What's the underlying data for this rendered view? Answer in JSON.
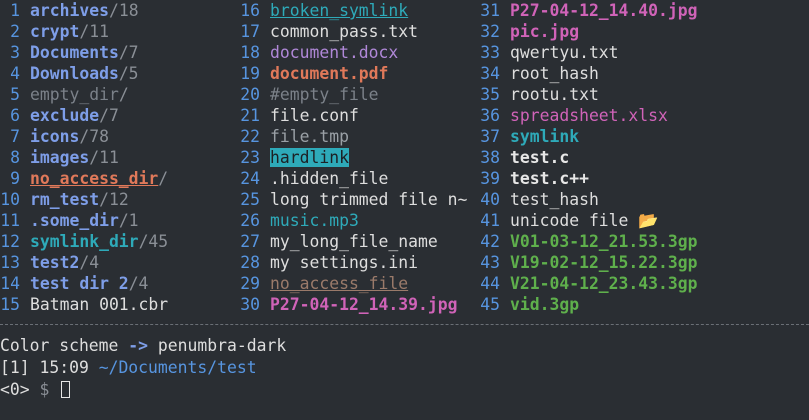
{
  "listing": {
    "col1": [
      {
        "n": "1",
        "name": "archives",
        "suffix": "/18",
        "kind": "dir"
      },
      {
        "n": "2",
        "name": "crypt",
        "suffix": "/11",
        "kind": "dir"
      },
      {
        "n": "3",
        "name": "Documents",
        "suffix": "/7",
        "kind": "dir"
      },
      {
        "n": "4",
        "name": "Downloads",
        "suffix": "/5",
        "kind": "dir"
      },
      {
        "n": "5",
        "name": "empty_dir",
        "suffix": "/",
        "kind": "emptydir"
      },
      {
        "n": "6",
        "name": "exclude",
        "suffix": "/7",
        "kind": "excl"
      },
      {
        "n": "7",
        "name": "icons",
        "suffix": "/78",
        "kind": "dir"
      },
      {
        "n": "8",
        "name": "images",
        "suffix": "/11",
        "kind": "dir"
      },
      {
        "n": "9",
        "name": "no_access_dir",
        "suffix": "/",
        "kind": "noacc"
      },
      {
        "n": "10",
        "name": "rm_test",
        "suffix": "/12",
        "kind": "dir"
      },
      {
        "n": "11",
        "name": ".some_dir",
        "suffix": "/1",
        "kind": "dir"
      },
      {
        "n": "12",
        "name": "symlink_dir",
        "suffix": "/45",
        "kind": "symdir"
      },
      {
        "n": "13",
        "name": "test2",
        "suffix": "/4",
        "kind": "dir"
      },
      {
        "n": "14",
        "name": "test dir 2",
        "suffix": "/4",
        "kind": "dir"
      },
      {
        "n": "15",
        "name": "Batman 001.cbr",
        "suffix": "",
        "kind": "plain"
      }
    ],
    "col2": [
      {
        "n": "16",
        "name": "broken_symlink",
        "kind": "broken"
      },
      {
        "n": "17",
        "name": "common_pass.txt",
        "kind": "plain"
      },
      {
        "n": "18",
        "name": "document.docx",
        "kind": "doc"
      },
      {
        "n": "19",
        "name": "document.pdf",
        "kind": "pdf"
      },
      {
        "n": "20",
        "name": "#empty_file",
        "kind": "cmt"
      },
      {
        "n": "21",
        "name": "file.conf",
        "kind": "plain"
      },
      {
        "n": "22",
        "name": "file.tmp",
        "kind": "tmp"
      },
      {
        "n": "23",
        "name": "hardlink",
        "kind": "hl"
      },
      {
        "n": "24",
        "name": ".hidden_file",
        "kind": "plain"
      },
      {
        "n": "25",
        "name": "long trimmed file n~",
        "kind": "plain"
      },
      {
        "n": "26",
        "name": "music.mp3",
        "kind": "music"
      },
      {
        "n": "27",
        "name": "my_long_file_name",
        "kind": "plain"
      },
      {
        "n": "28",
        "name": "my settings.ini",
        "kind": "plain"
      },
      {
        "n": "29",
        "name": "no_access_file",
        "kind": "noaccf"
      },
      {
        "n": "30",
        "name": "P27-04-12_14.39.jpg",
        "kind": "img"
      }
    ],
    "col3": [
      {
        "n": "31",
        "name": "P27-04-12_14.40.jpg",
        "kind": "img"
      },
      {
        "n": "32",
        "name": "pic.jpg",
        "kind": "img"
      },
      {
        "n": "33",
        "name": "qwertyu.txt",
        "kind": "plain"
      },
      {
        "n": "34",
        "name": "root_hash",
        "kind": "plain"
      },
      {
        "n": "35",
        "name": "rootu.txt",
        "kind": "plain"
      },
      {
        "n": "36",
        "name": "spreadsheet.xlsx",
        "kind": "xls"
      },
      {
        "n": "37",
        "name": "symlink",
        "kind": "sym"
      },
      {
        "n": "38",
        "name": "test.c",
        "kind": "csrc"
      },
      {
        "n": "39",
        "name": "test.c++",
        "kind": "csrc"
      },
      {
        "n": "40",
        "name": "test_hash",
        "kind": "plain"
      },
      {
        "n": "41",
        "name": "unicode file 📂",
        "kind": "plain"
      },
      {
        "n": "42",
        "name": "V01-03-12_21.53.3gp",
        "kind": "green"
      },
      {
        "n": "43",
        "name": "V19-02-12_15.22.3gp",
        "kind": "green"
      },
      {
        "n": "44",
        "name": "V21-04-12_23.43.3gp",
        "kind": "green"
      },
      {
        "n": "45",
        "name": "vid.3gp",
        "kind": "green"
      }
    ]
  },
  "footer": {
    "scheme_label": "Color scheme",
    "arrow": "->",
    "scheme_value": "penumbra-dark",
    "context": "[1]",
    "time": "15:09",
    "path": "~/Documents/test",
    "prompt_count": "<0>",
    "prompt_symbol": "$"
  },
  "colors": {
    "background": "#2a2e33",
    "number": "#5795e0",
    "directory": "#7e9ee8",
    "symlink": "#2eaab9",
    "image": "#d063b8",
    "video": "#5fb04c",
    "no_access": "#e0795a"
  }
}
